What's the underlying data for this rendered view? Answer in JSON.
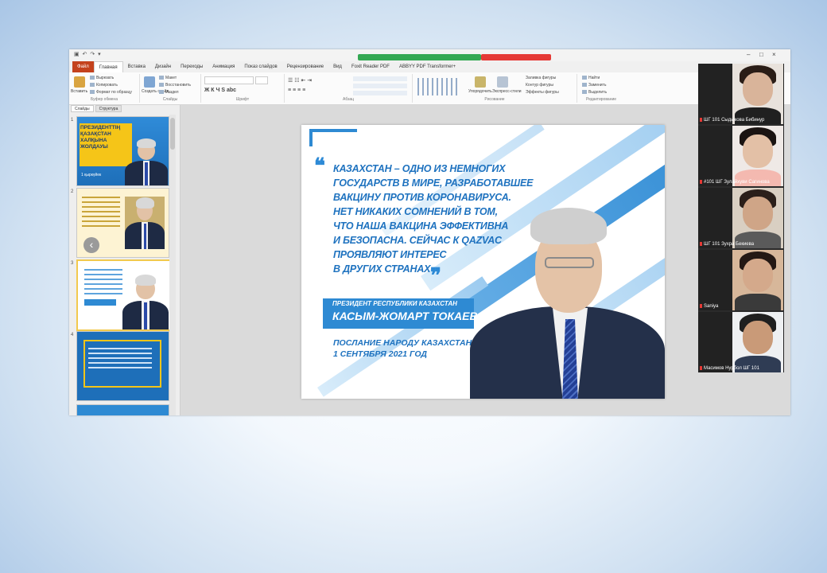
{
  "app": {
    "tabs": [
      "Файл",
      "Главная",
      "Вставка",
      "Дизайн",
      "Переходы",
      "Анимация",
      "Показ слайдов",
      "Рецензирование",
      "Вид",
      "Foxit Reader PDF",
      "ABBYY PDF Transformer+"
    ],
    "ribbon_groups": [
      "Буфер обмена",
      "Слайды",
      "Шрифт",
      "Абзац",
      "Рисование",
      "Редактирование"
    ],
    "ribbon_items": {
      "paste": "Вставить",
      "cut": "Вырезать",
      "copy": "Копировать",
      "format_painter": "Формат по образцу",
      "new_slide": "Создать слайд",
      "layout": "Макет",
      "reset": "Восстановить",
      "section": "Раздел",
      "arrange": "Упорядочить",
      "quick_styles": "Экспресс-стили",
      "shape_fill": "Заливка фигуры",
      "shape_outline": "Контур фигуры",
      "shape_effects": "Эффекты фигуры",
      "find": "Найти",
      "replace": "Заменить",
      "select": "Выделить"
    }
  },
  "slides_pane": {
    "tabs": [
      "Слайды",
      "Структура"
    ],
    "numbers": [
      "1",
      "2",
      "3",
      "4"
    ],
    "slide1_title": "ПРЕЗИДЕНТТІҢ ҚАЗАҚСТАН ХАЛҚЫНА ЖОЛДАУЫ",
    "slide1_date": "1 қыркүйек"
  },
  "main_slide": {
    "quote_open": "❝",
    "quote_close": "❞",
    "quote_lines": [
      "КАЗАХСТАН – ОДНО ИЗ НЕМНОГИХ",
      "ГОСУДАРСТВ В МИРЕ, РАЗРАБОТАВШЕЕ",
      "ВАКЦИНУ ПРОТИВ КОРОНАВИРУСА.",
      "НЕТ НИКАКИХ СОМНЕНИЙ В ТОМ,",
      "ЧТО НАША ВАКЦИНА ЭФФЕКТИВНА",
      "И БЕЗОПАСНА. СЕЙЧАС К QAZVAC",
      "ПРОЯВЛЯЮТ ИНТЕРЕС",
      "В ДРУГИХ СТРАНАХ"
    ],
    "position": "ПРЕЗИДЕНТ РЕСПУБЛИКИ КАЗАХСТАН",
    "name": "КАСЫМ-ЖОМАРТ ТОКАЕВ",
    "address_line1": "ПОСЛАНИЕ НАРОДУ КАЗАХСТАНА",
    "address_line2": "1 СЕНТЯБРЯ 2021 ГОД",
    "accent_color": "#2e8ad3"
  },
  "participants": [
    {
      "name": "ШГ 101 Сыдыкова Бибинур",
      "muted": true
    },
    {
      "name": "#101 ШГ Зулайхуви Сагинова",
      "muted": true
    },
    {
      "name": "ШГ 101 Зухра Бекиева",
      "muted": true
    },
    {
      "name": "Saniya",
      "muted": true
    },
    {
      "name": "Масимов Нурбол ШГ 101",
      "muted": true
    }
  ]
}
